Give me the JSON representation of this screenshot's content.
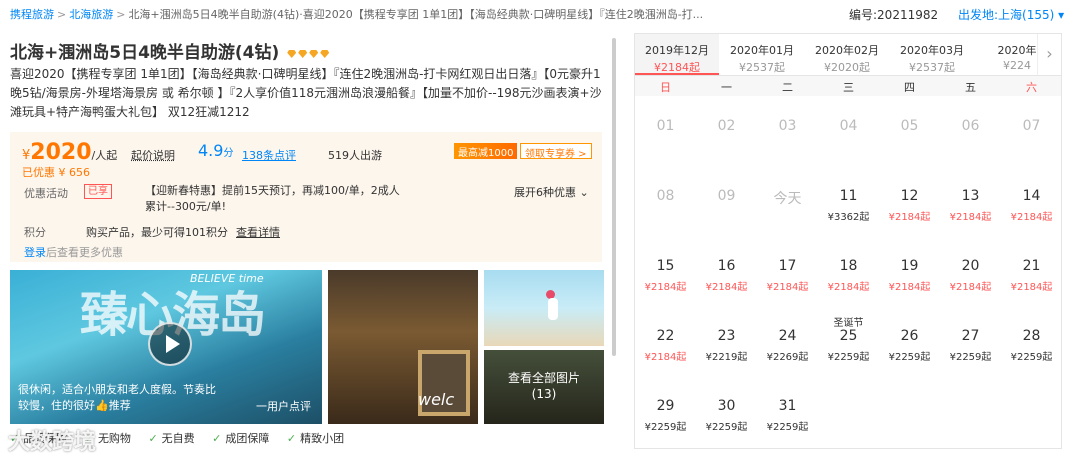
{
  "breadcrumb": {
    "items": [
      "携程旅游",
      "北海旅游"
    ],
    "current": "北海+涠洲岛5日4晚半自助游(4钻)·喜迎2020【携程专享团 1单1团】【海岛经典款·口碑明星线】『连住2晚涠洲岛-打..."
  },
  "product_code": "编号:20211982",
  "departure": "出发地:上海(155)",
  "title": "北海+涠洲岛5日4晚半自助游(4钻)",
  "description": "喜迎2020【携程专享团 1单1团】【海岛经典款·口碑明星线】『连住2晚涠洲岛-打卡网红观日出日落』【0元豪升1晚5钻/海景房-外瑆塔海景房 或 希尔顿 】『2人享价值118元涠洲岛浪漫船餐』【加量不加价--198元沙画表演+沙滩玩具+特产海鸭蛋大礼包】 双12狂减1212",
  "price": {
    "symbol": "¥",
    "value": "2020",
    "unit": "/人起",
    "explain": "起价说明",
    "score": "4.9",
    "score_unit": "分",
    "reviews": "138条点评",
    "travelers": "519人出游",
    "saved": "已优惠 ¥ 656",
    "max_off": "最高减1000",
    "coupon": "领取专享券 >"
  },
  "promotions": {
    "label": "优惠活动",
    "enjoyed": "已享",
    "text": "【迎新春特惠】提前15天预订，再减100/单，2成人累计--300元/单!",
    "expand": "展开6种优惠 ⌄"
  },
  "points": {
    "label": "积分",
    "text": "购买产品，最少可得101积分",
    "link": "查看详情"
  },
  "login_tip": {
    "link": "登录",
    "text": "后查看更多优惠"
  },
  "gallery": {
    "main_big_text": "臻心海岛",
    "main_script": "BELIEVE time",
    "caption": "很休闲，适合小朋友和老人度假。节奏比较慢，住的很好👍推荐",
    "caption_right": "一用户点评",
    "welcome": "welc",
    "view_all": "查看全部图片",
    "count": "(13)"
  },
  "tags": [
    "品质保障",
    "无购物",
    "无自费",
    "成团保障",
    "精致小团"
  ],
  "watermark": "大数跨境",
  "calendar": {
    "months": [
      {
        "label": "2019年12月",
        "price": "¥2184起",
        "selected": true
      },
      {
        "label": "2020年01月",
        "price": "¥2537起"
      },
      {
        "label": "2020年02月",
        "price": "¥2020起"
      },
      {
        "label": "2020年03月",
        "price": "¥2537起"
      },
      {
        "label": "2020年",
        "price": "¥224"
      }
    ],
    "weekdays": [
      "日",
      "一",
      "二",
      "三",
      "四",
      "五",
      "六"
    ],
    "days": [
      {
        "d": "01",
        "gray": true
      },
      {
        "d": "02",
        "gray": true
      },
      {
        "d": "03",
        "gray": true
      },
      {
        "d": "04",
        "gray": true
      },
      {
        "d": "05",
        "gray": true
      },
      {
        "d": "06",
        "gray": true
      },
      {
        "d": "07",
        "gray": true
      },
      {
        "d": "08",
        "gray": true
      },
      {
        "d": "09",
        "gray": true
      },
      {
        "d": "今天",
        "gray": true
      },
      {
        "d": "11",
        "p": "¥3362起",
        "red": false
      },
      {
        "d": "12",
        "p": "¥2184起",
        "red": true
      },
      {
        "d": "13",
        "p": "¥2184起",
        "red": true
      },
      {
        "d": "14",
        "p": "¥2184起",
        "red": true
      },
      {
        "d": "15",
        "p": "¥2184起",
        "red": true
      },
      {
        "d": "16",
        "p": "¥2184起",
        "red": true
      },
      {
        "d": "17",
        "p": "¥2184起",
        "red": true
      },
      {
        "d": "18",
        "p": "¥2184起",
        "red": true
      },
      {
        "d": "19",
        "p": "¥2184起",
        "red": true
      },
      {
        "d": "20",
        "p": "¥2184起",
        "red": true
      },
      {
        "d": "21",
        "p": "¥2184起",
        "red": true
      },
      {
        "d": "22",
        "p": "¥2184起",
        "red": true
      },
      {
        "d": "23",
        "p": "¥2219起",
        "red": false
      },
      {
        "d": "24",
        "p": "¥2269起",
        "red": false
      },
      {
        "d": "25",
        "p": "¥2259起",
        "red": false,
        "hol": "圣诞节"
      },
      {
        "d": "26",
        "p": "¥2259起",
        "red": false
      },
      {
        "d": "27",
        "p": "¥2259起",
        "red": false
      },
      {
        "d": "28",
        "p": "¥2259起",
        "red": false
      },
      {
        "d": "29",
        "p": "¥2259起",
        "red": false
      },
      {
        "d": "30",
        "p": "¥2259起",
        "red": false
      },
      {
        "d": "31",
        "p": "¥2259起",
        "red": false
      }
    ]
  },
  "colors": {
    "accent": "#0086f6",
    "price": "#ff7700",
    "red": "#f55"
  }
}
